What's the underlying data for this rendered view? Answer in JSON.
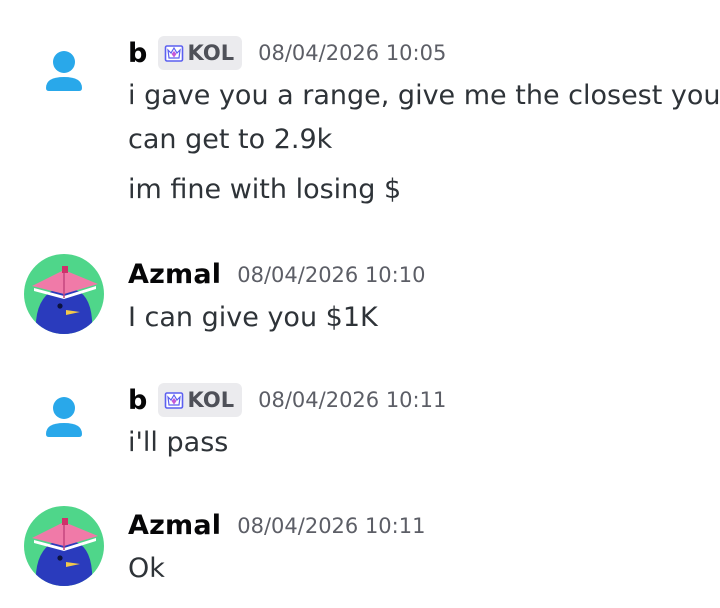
{
  "messages": [
    {
      "author": "b",
      "badge": "KOL",
      "timestamp": "08/04/2026 10:05",
      "lines": [
        "i gave you a range, give me the closest you",
        "can get to 2.9k",
        "im fine with losing $"
      ]
    },
    {
      "author": "Azmal",
      "timestamp": "08/04/2026 10:10",
      "lines": [
        "I can give you $1K"
      ]
    },
    {
      "author": "b",
      "badge": "KOL",
      "timestamp": "08/04/2026 10:11",
      "lines": [
        "i'll pass"
      ]
    },
    {
      "author": "Azmal",
      "timestamp": "08/04/2026 10:11",
      "lines": [
        "Ok"
      ]
    }
  ],
  "colors": {
    "default_avatar": "#29a8ea",
    "azmal_avatar_bg": "#4fd68a",
    "azmal_character": "#2a3bbd",
    "azmal_hat": "#f07aa8",
    "badge_bg": "#ebebee"
  },
  "icons": {
    "default_avatar": "user-silhouette-icon",
    "azmal_avatar": "bird-with-book-hat-avatar",
    "badge": "crown-gem-icon"
  }
}
